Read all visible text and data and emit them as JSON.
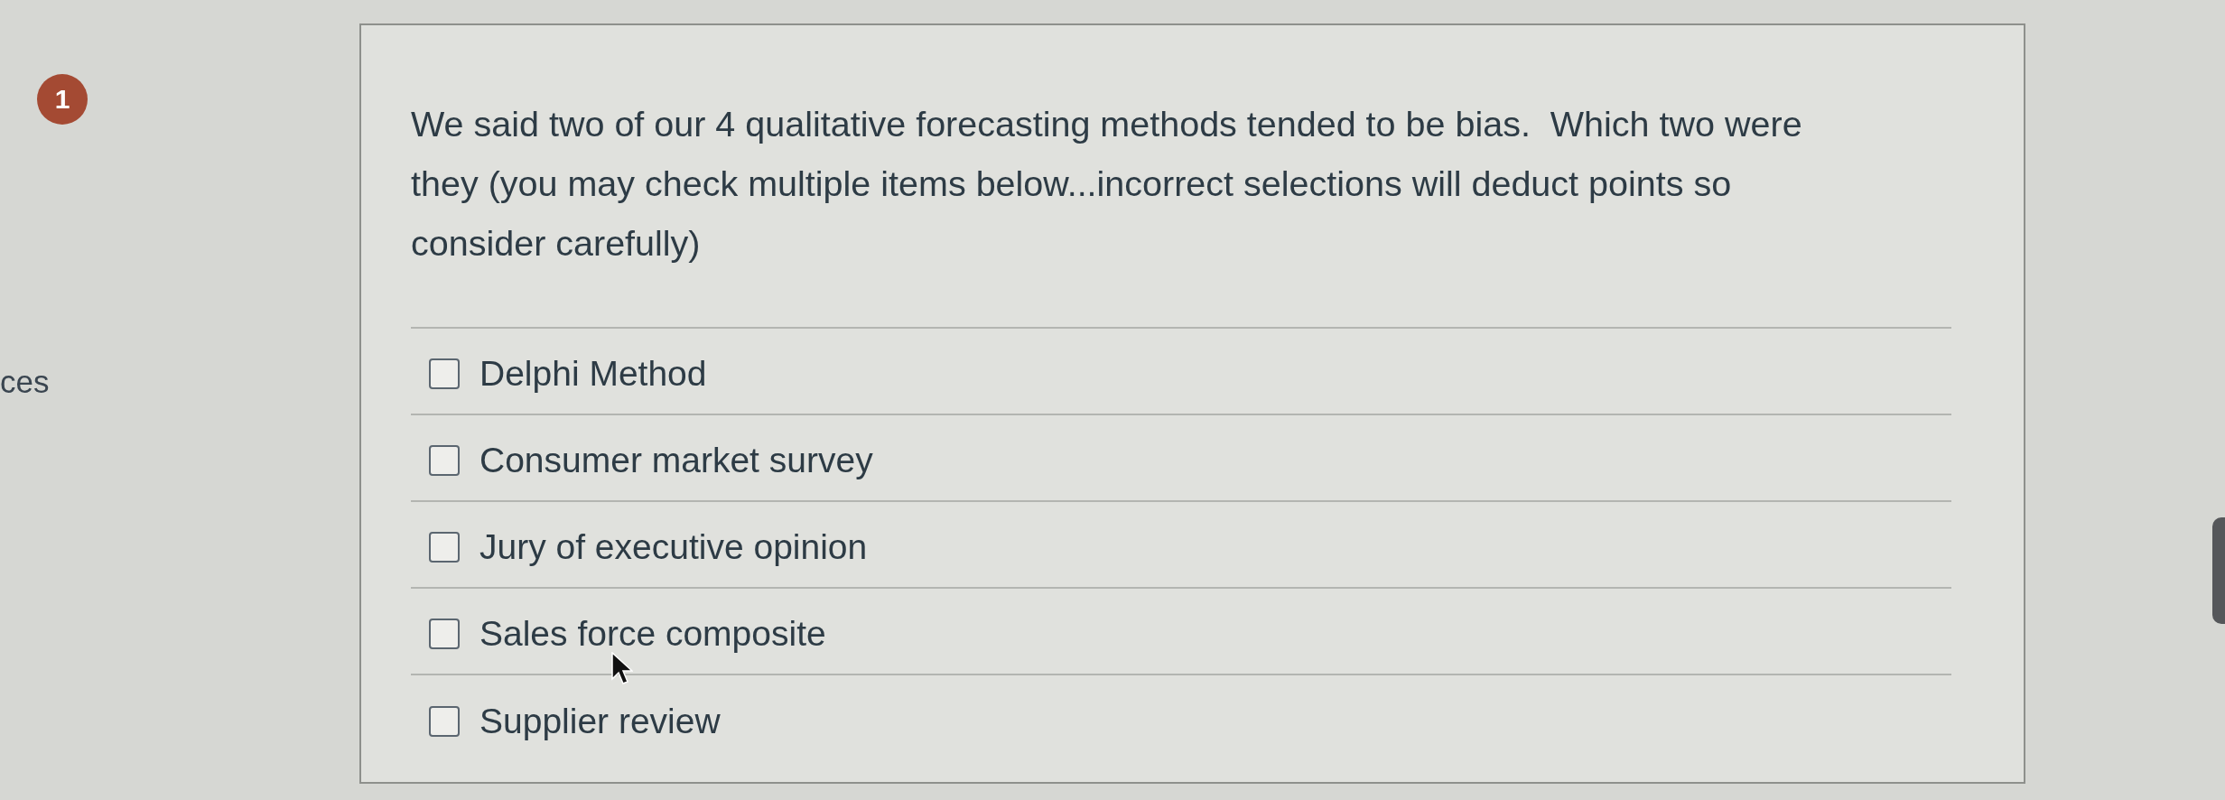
{
  "sidebar": {
    "question_number": "1",
    "cut_text": "ces"
  },
  "question": {
    "text": "We said two of our 4 qualitative forecasting methods tended to be bias.  Which two were they (you may check multiple items below...incorrect selections will deduct points so consider carefully)",
    "options": [
      {
        "label": "Delphi Method",
        "checked": false
      },
      {
        "label": "Consumer market survey",
        "checked": false
      },
      {
        "label": "Jury of executive opinion",
        "checked": false
      },
      {
        "label": "Sales force composite",
        "checked": false
      },
      {
        "label": "Supplier review",
        "checked": false
      }
    ]
  }
}
